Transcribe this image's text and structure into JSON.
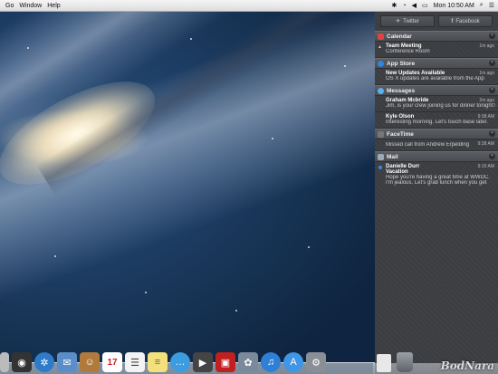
{
  "menubar": {
    "items": [
      "Go",
      "Window",
      "Help"
    ],
    "time": "Mon 10:50 AM"
  },
  "notification_center": {
    "share_buttons": [
      "Twitter",
      "Facebook"
    ],
    "sections": [
      {
        "title": "Calendar",
        "icon": "calendar-icon",
        "items": [
          {
            "title": "Team Meeting",
            "time": "1m ago",
            "body": "Conference Room"
          }
        ]
      },
      {
        "title": "App Store",
        "icon": "app-store-icon",
        "items": [
          {
            "title": "New Updates Available",
            "time": "1m ago",
            "body": "OS X updates are available from the App"
          }
        ]
      },
      {
        "title": "Messages",
        "icon": "messages-icon",
        "items": [
          {
            "title": "Graham Mcbride",
            "time": "2m ago",
            "body": "Jim, is your crew joining us for dinner tonight?"
          },
          {
            "title": "Kyle Olson",
            "time": "9:38 AM",
            "body": "Interesting morning. Let's touch base later."
          }
        ]
      },
      {
        "title": "FaceTime",
        "icon": "facetime-icon",
        "items": [
          {
            "title": "",
            "time": "9:38 AM",
            "body": "Missed call from Andrew Erpelding"
          }
        ]
      },
      {
        "title": "Mail",
        "icon": "mail-icon",
        "items": [
          {
            "title": "Danielle Durr",
            "time": "9:10 AM",
            "subtitle": "Vacation",
            "body": "Hope you're having a great time at WWDC.",
            "body2": "I'm jealous. Let's grab lunch when you get"
          }
        ]
      }
    ]
  },
  "dock": {
    "icons": [
      "finder-icon",
      "dashboard-icon",
      "safari-icon",
      "mail-stamp-icon",
      "contacts-icon",
      "calendar-dock-icon",
      "reminders-icon",
      "notes-icon",
      "messages-dock-icon",
      "facetime-dock-icon",
      "photo-booth-icon",
      "iphoto-icon",
      "itunes-icon",
      "app-store-dock-icon",
      "system-preferences-icon"
    ],
    "calendar_day": "17"
  },
  "watermark": "BodNara"
}
